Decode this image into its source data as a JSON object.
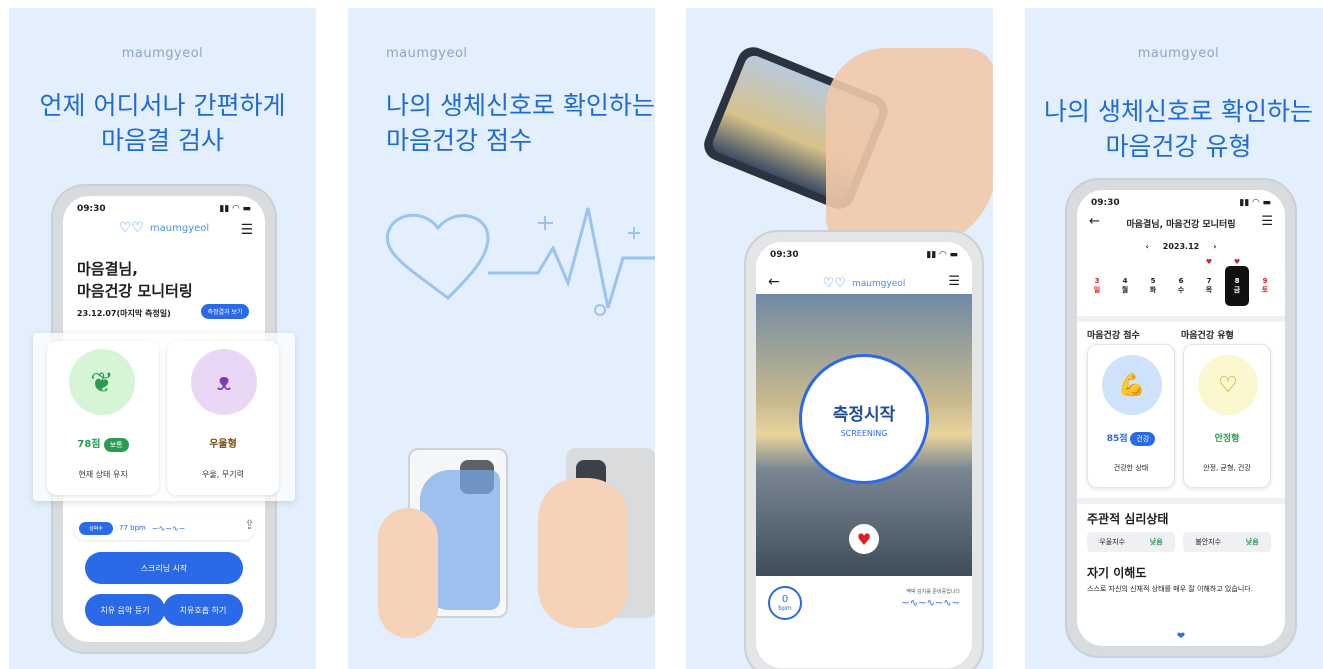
{
  "brand": "maumgyeol",
  "p1": {
    "headline_1": "언제 어디서나 간편하게",
    "headline_2": "마음결 검사",
    "time": "09:30",
    "greeting_1": "마음결님,",
    "greeting_2": "마음건강 모니터링",
    "date_note": "23.12.07(마지막 측정일)",
    "result_btn": "측정결과 보기",
    "score_value": "78점",
    "score_badge": "보통",
    "score_caption": "현재 상태 유지",
    "type_value": "우울형",
    "type_caption": "우울, 무기력",
    "hr_label": "심박수",
    "hr_value": "77 bpm",
    "start_btn": "스크리닝 시작",
    "music_btn": "치유 음악 듣기",
    "breath_btn": "치유호흡 하기",
    "colors": {
      "leaf_bg": "#d6f5d6",
      "face_bg": "#ead7f5",
      "green": "#2a9c51",
      "blue": "#2a6ae8"
    }
  },
  "p2": {
    "headline_1": "나의 생체신호로 확인하는",
    "headline_2": "마음건강 점수"
  },
  "p3": {
    "time": "09:30",
    "measure_title": "측정시작",
    "measure_sub": "SCREENING",
    "bpm_value": "0",
    "bpm_unit": "bpm",
    "waiting_text": "맥박 감지를 준비중입니다"
  },
  "p4": {
    "headline_1": "나의 생체신호로 확인하는",
    "headline_2": "마음건강 유형",
    "time": "09:30",
    "title": "마음결님, 마음건강 모니터링",
    "month": "2023.12",
    "days": [
      {
        "num": "3",
        "dow": "일",
        "color": "red"
      },
      {
        "num": "4",
        "dow": "월",
        "color": "black"
      },
      {
        "num": "5",
        "dow": "화",
        "color": "black"
      },
      {
        "num": "6",
        "dow": "수",
        "color": "black"
      },
      {
        "num": "7",
        "dow": "목",
        "color": "black"
      },
      {
        "num": "8",
        "dow": "금",
        "color": "selected"
      },
      {
        "num": "9",
        "dow": "토",
        "color": "red"
      }
    ],
    "score_heading": "마음건강 점수",
    "type_heading": "마음건강 유형",
    "score_value": "85점",
    "score_badge": "건강",
    "score_caption": "건강한 상태",
    "type_value": "안정형",
    "type_caption": "안정, 균형, 건강",
    "subjective_heading": "주관적 심리상태",
    "depress_label": "우울지수",
    "depress_value": "낮음",
    "anxiety_label": "불안지수",
    "anxiety_value": "낮음",
    "self_heading": "자기 이해도",
    "self_text": "스스로 자신의 신체적 상태를 매우 잘 이해하고 있습니다."
  }
}
